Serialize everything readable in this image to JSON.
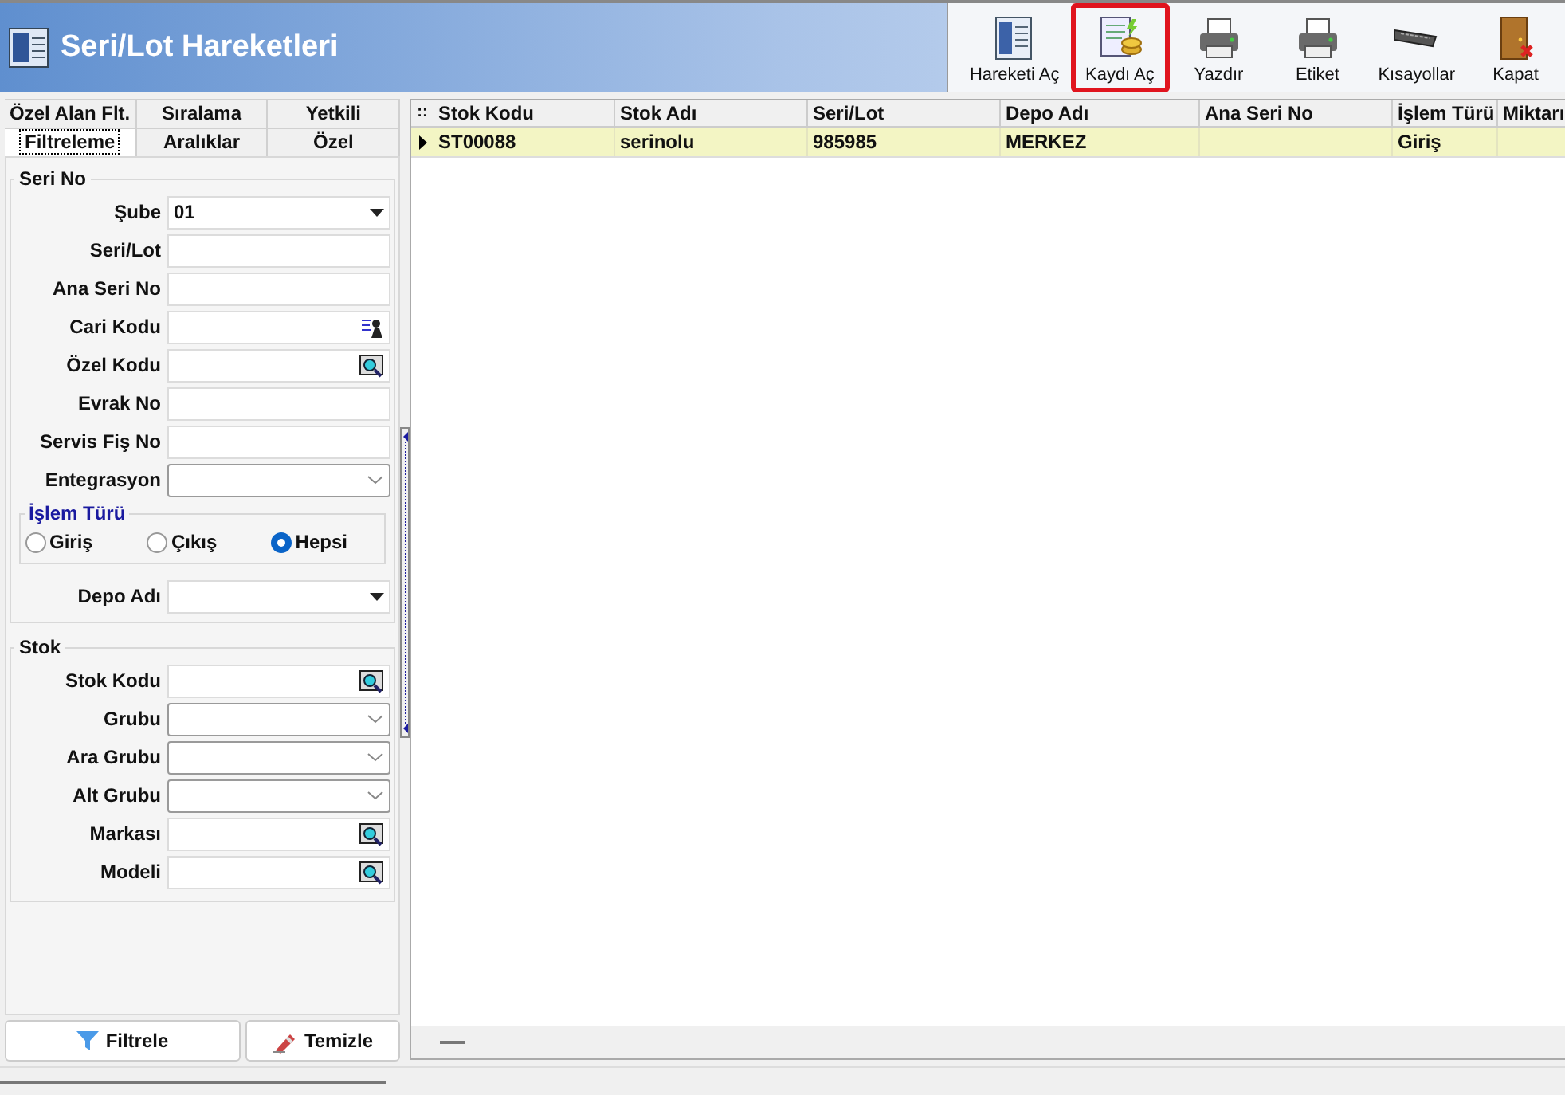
{
  "window": {
    "title": "Seri/Lot Hareketleri"
  },
  "toolbar": [
    {
      "label": "Hareketi Aç",
      "kind": "grid",
      "highlighted": false
    },
    {
      "label": "Kaydı Aç",
      "kind": "record",
      "highlighted": true
    },
    {
      "label": "Yazdır",
      "kind": "printer",
      "highlighted": false
    },
    {
      "label": "Etiket",
      "kind": "printer",
      "highlighted": false
    },
    {
      "label": "Kısayollar",
      "kind": "keyboard",
      "highlighted": false
    },
    {
      "label": "Kapat",
      "kind": "door",
      "highlighted": false
    }
  ],
  "tabs_back": [
    {
      "label": "Özel Alan Flt.",
      "selected": false
    },
    {
      "label": "Sıralama",
      "selected": false
    },
    {
      "label": "Yetkili",
      "selected": false
    }
  ],
  "tabs_front": [
    {
      "label": "Filtreleme",
      "selected": true
    },
    {
      "label": "Aralıklar",
      "selected": false
    },
    {
      "label": "Özel",
      "selected": false
    }
  ],
  "seri_no": {
    "title": "Seri No",
    "fields": [
      {
        "label": "Şube",
        "kind": "select",
        "value": "01"
      },
      {
        "label": "Seri/Lot",
        "kind": "text"
      },
      {
        "label": "Ana Seri No",
        "kind": "text"
      },
      {
        "label": "Cari Kodu",
        "kind": "picker"
      },
      {
        "label": "Özel Kodu",
        "kind": "search"
      },
      {
        "label": "Evrak No",
        "kind": "text"
      },
      {
        "label": "Servis Fiş No",
        "kind": "text"
      },
      {
        "label": "Entegrasyon",
        "kind": "combo"
      }
    ],
    "islem_turu": {
      "title": "İşlem Türü",
      "options": [
        {
          "label": "Giriş",
          "selected": false
        },
        {
          "label": "Çıkış",
          "selected": false
        },
        {
          "label": "Hepsi",
          "selected": true
        }
      ]
    },
    "after": [
      {
        "label": "Depo Adı",
        "kind": "select"
      }
    ]
  },
  "stok": {
    "title": "Stok",
    "fields": [
      {
        "label": "Stok Kodu",
        "kind": "search"
      },
      {
        "label": "Grubu",
        "kind": "combo"
      },
      {
        "label": "Ara Grubu",
        "kind": "combo"
      },
      {
        "label": "Alt Grubu",
        "kind": "combo"
      },
      {
        "label": "Markası",
        "kind": "search"
      },
      {
        "label": "Modeli",
        "kind": "search"
      }
    ]
  },
  "buttons": [
    {
      "label": "Filtrele",
      "kind": "funnel"
    },
    {
      "label": "Temizle",
      "kind": "eraser"
    }
  ],
  "table": {
    "corner": "::",
    "columns": [
      "Stok Kodu",
      "Stok Adı",
      "Seri/Lot",
      "Depo Adı",
      "Ana Seri No",
      "İşlem Türü",
      "Miktarı"
    ],
    "rows": [
      {
        "selected": true,
        "cells": [
          "ST00088",
          "serinolu",
          "985985",
          "MERKEZ",
          "",
          "Giriş",
          ""
        ]
      }
    ]
  }
}
